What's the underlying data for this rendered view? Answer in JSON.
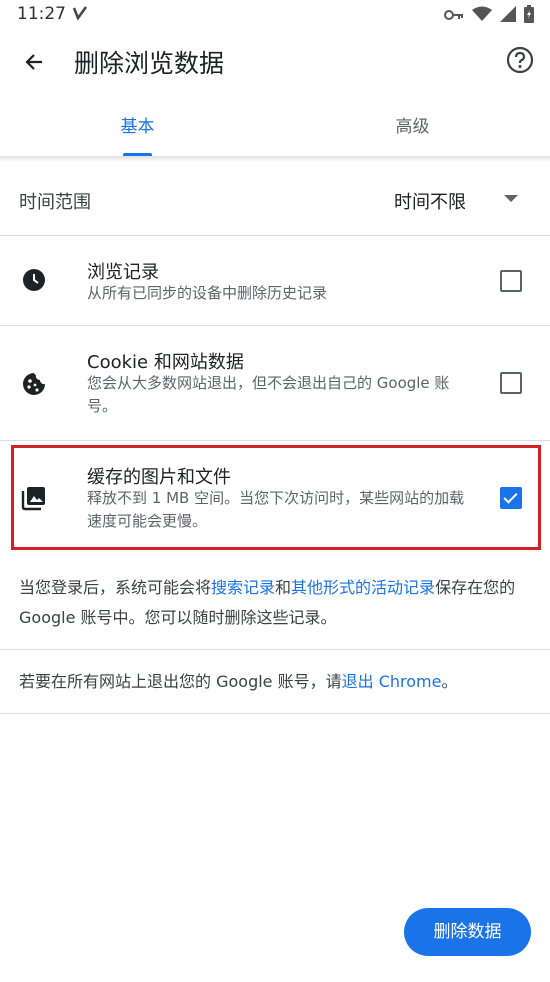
{
  "status_bar": {
    "time": "11:27",
    "icons": [
      "vpn-key-icon",
      "wifi-icon",
      "signal-icon",
      "battery-icon"
    ]
  },
  "app_bar": {
    "title": "删除浏览数据",
    "back_icon": "back-arrow-icon",
    "help_icon": "help-icon"
  },
  "tabs": [
    {
      "label": "基本",
      "selected": true
    },
    {
      "label": "高级",
      "selected": false
    }
  ],
  "time_range": {
    "label": "时间范围",
    "value": "时间不限"
  },
  "options": [
    {
      "icon": "clock-icon",
      "title": "浏览记录",
      "description": "从所有已同步的设备中删除历史记录",
      "checked": false
    },
    {
      "icon": "cookie-icon",
      "title": "Cookie 和网站数据",
      "description": "您会从大多数网站退出，但不会退出自己的 Google 账号。",
      "checked": false
    },
    {
      "icon": "image-icon",
      "title": "缓存的图片和文件",
      "description": "释放不到 1 MB 空间。当您下次访问时，某些网站的加载速度可能会更慢。",
      "checked": true
    }
  ],
  "info": {
    "p1_before": "当您登录后，系统可能会将",
    "p1_link1": "搜索记录",
    "p1_mid": "和",
    "p1_link2": "其他形式的活动记录",
    "p1_after": "保存在您的 Google 账号中。您可以随时删除这些记录。",
    "p2_before": "若要在所有网站上退出您的 Google 账号，请",
    "p2_link": "退出 Chrome",
    "p2_after": "。"
  },
  "delete_button": "删除数据",
  "colors": {
    "accent": "#1a73e8",
    "highlight": "#d32027"
  }
}
